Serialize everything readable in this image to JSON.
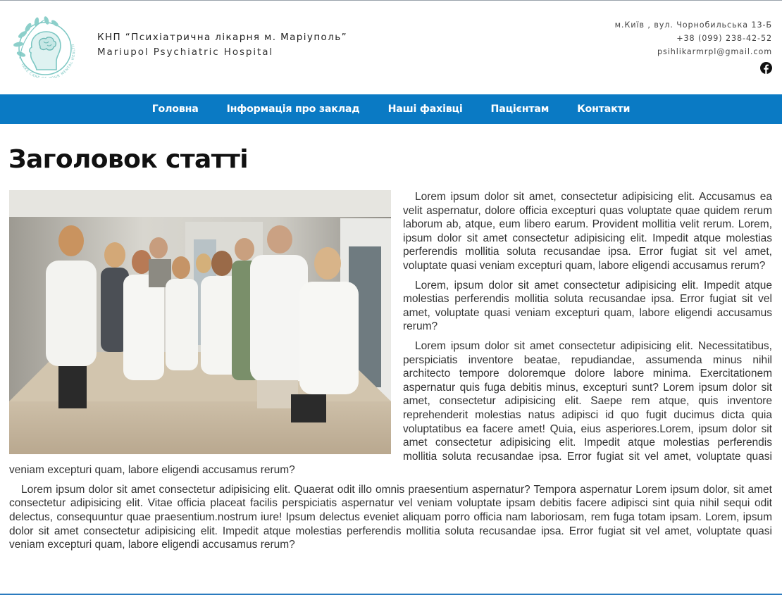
{
  "header": {
    "name_ua": "КНП “Психіатрична лікарня м. Маріуполь”",
    "name_en": "Mariupol Psychiatric Hospital",
    "logo_motto": "TAKE CARE OF YOUR MENTAL HEALTH",
    "address": "м.Київ , вул. Чорнобильська 13-Б",
    "phone": "+38 (099) 238-42-52",
    "email": "psihlikarmrpl@gmail.com",
    "social_icon": "facebook-icon"
  },
  "nav": {
    "items": [
      "Головна",
      "Інформація про заклад",
      "Наші фахівці",
      "Пацієнтам",
      "Контакти"
    ]
  },
  "article": {
    "title": "Заголовок статті",
    "paragraphs": [
      "Lorem ipsum dolor sit amet, consectetur adipisicing elit. Accusamus ea velit aspernatur, dolore officia excepturi quas voluptate quae quidem rerum laborum ab, atque, eum libero earum. Provident mollitia velit rerum. Lorem, ipsum dolor sit amet consectetur adipisicing elit. Impedit atque molestias perferendis mollitia soluta recusandae ipsa. Error fugiat sit vel amet, voluptate quasi veniam excepturi quam, labore eligendi accusamus rerum?",
      "Lorem, ipsum dolor sit amet consectetur adipisicing elit. Impedit atque molestias perferendis mollitia soluta recusandae ipsa. Error fugiat sit vel amet, voluptate quasi veniam excepturi quam, labore eligendi accusamus rerum?",
      "Lorem ipsum dolor sit amet consectetur adipisicing elit. Necessitatibus, perspiciatis inventore beatae, repudiandae, assumenda minus nihil architecto tempore doloremque dolore labore minima. Exercitationem aspernatur quis fuga debitis minus, excepturi sunt? Lorem ipsum dolor sit amet, consectetur adipisicing elit. Saepe rem atque, quis inventore reprehenderit molestias natus adipisci id quo fugit ducimus dicta quia voluptatibus ea facere amet! Quia, eius asperiores.Lorem, ipsum dolor sit amet consectetur adipisicing elit. Impedit atque molestias perferendis mollitia soluta recusandae ipsa. Error fugiat sit vel amet, voluptate quasi veniam excepturi quam, labore eligendi accusamus rerum?",
      "Lorem ipsum dolor sit amet consectetur adipisicing elit. Quaerat odit illo omnis praesentium aspernatur? Tempora aspernatur Lorem ipsum dolor, sit amet consectetur adipisicing elit. Vitae officia placeat facilis perspiciatis aspernatur vel veniam voluptate ipsam debitis facere adipisci sint quia nihil sequi odit delectus, consequuntur quae praesentium.nostrum iure! Ipsum delectus eveniet aliquam porro officia nam laboriosam, rem fuga totam ipsam. Lorem, ipsum dolor sit amet consectetur adipisicing elit. Impedit atque molestias perferendis mollitia soluta recusandae ipsa. Error fugiat sit vel amet, voluptate quasi veniam excepturi quam, labore eligendi accusamus rerum?"
    ]
  },
  "colors": {
    "nav_background": "#0a7ac4",
    "logo_teal": "#7cc7c3",
    "footer_rule": "#2b7bbf"
  }
}
